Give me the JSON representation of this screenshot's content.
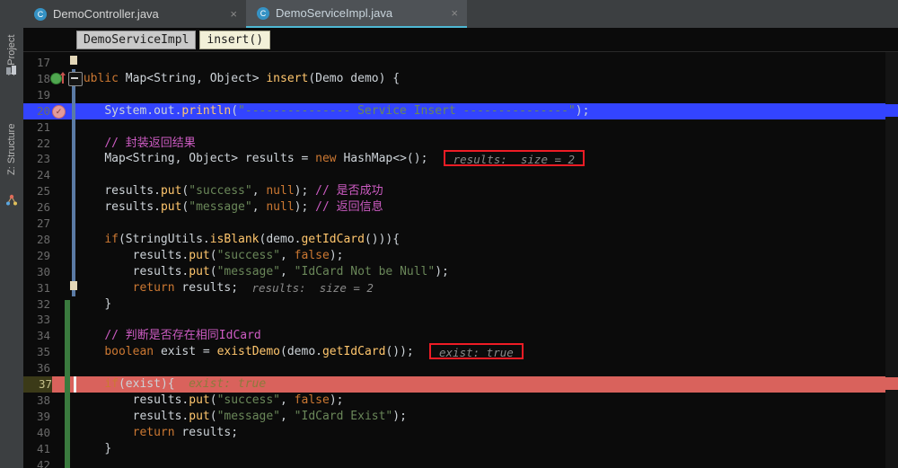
{
  "window": {
    "sidebar": {
      "items": [
        {
          "label": "1: Project",
          "icon": "project-icon"
        },
        {
          "label": "Z: Structure",
          "icon": "structure-icon"
        }
      ]
    },
    "tabs": [
      {
        "label": "DemoController.java",
        "icon": "java-class-icon",
        "close": "×",
        "active": false
      },
      {
        "label": "DemoServiceImpl.java",
        "icon": "java-class-icon",
        "close": "×",
        "active": true
      }
    ],
    "breadcrumb": {
      "class_name": "DemoServiceImpl",
      "method_name": "insert()"
    }
  },
  "editor": {
    "first_line": 17,
    "last_line": 42,
    "current_line": 37,
    "gutter_icons": [
      {
        "line": 18,
        "icon": "run-gutter-icon"
      },
      {
        "line": 20,
        "icon": "breakpoint-verified-icon"
      }
    ],
    "lines": [
      {
        "n": 17,
        "indent": 0,
        "text": ""
      },
      {
        "n": 18,
        "indent": 0,
        "text": "public Map<String, Object> insert(Demo demo) {"
      },
      {
        "n": 19,
        "indent": 0,
        "text": ""
      },
      {
        "n": 20,
        "indent": 0,
        "text": "    System.out.println(\"--------------- Service Insert ---------------\");",
        "highlight": "blue"
      },
      {
        "n": 21,
        "indent": 0,
        "text": ""
      },
      {
        "n": 22,
        "indent": 0,
        "text": "    // 封装返回结果"
      },
      {
        "n": 23,
        "indent": 0,
        "text": "    Map<String, Object> results = new HashMap<>();"
      },
      {
        "n": 24,
        "indent": 0,
        "text": ""
      },
      {
        "n": 25,
        "indent": 0,
        "text": "    results.put(\"success\", null); // 是否成功"
      },
      {
        "n": 26,
        "indent": 0,
        "text": "    results.put(\"message\", null); // 返回信息"
      },
      {
        "n": 27,
        "indent": 0,
        "text": ""
      },
      {
        "n": 28,
        "indent": 0,
        "text": "    if(StringUtils.isBlank(demo.getIdCard())){"
      },
      {
        "n": 29,
        "indent": 0,
        "text": "        results.put(\"success\", false);"
      },
      {
        "n": 30,
        "indent": 0,
        "text": "        results.put(\"message\", \"IdCard Not be Null\");"
      },
      {
        "n": 31,
        "indent": 0,
        "text": "        return results;"
      },
      {
        "n": 32,
        "indent": 0,
        "text": "    }"
      },
      {
        "n": 33,
        "indent": 0,
        "text": ""
      },
      {
        "n": 34,
        "indent": 0,
        "text": "    // 判断是否存在相同IdCard"
      },
      {
        "n": 35,
        "indent": 0,
        "text": "    boolean exist = existDemo(demo.getIdCard());"
      },
      {
        "n": 36,
        "indent": 0,
        "text": ""
      },
      {
        "n": 37,
        "indent": 0,
        "text": "    if(exist){",
        "highlight": "red"
      },
      {
        "n": 38,
        "indent": 0,
        "text": "        results.put(\"success\", false);"
      },
      {
        "n": 39,
        "indent": 0,
        "text": "        results.put(\"message\", \"IdCard Exist\");"
      },
      {
        "n": 40,
        "indent": 0,
        "text": "        return results;"
      },
      {
        "n": 41,
        "indent": 0,
        "text": "    }"
      },
      {
        "n": 42,
        "indent": 0,
        "text": ""
      }
    ],
    "inline_hints": [
      {
        "line": 23,
        "text": "results:  size = 2",
        "boxed": true,
        "highlight_color": "#ee1c25"
      },
      {
        "line": 31,
        "text": "results:  size = 2",
        "boxed": false
      },
      {
        "line": 35,
        "text": "exist: true",
        "boxed": true,
        "highlight_color": "#ee1c25"
      },
      {
        "line": 37,
        "text": "exist: true",
        "boxed": false,
        "on_exec_line": true
      }
    ]
  },
  "colors": {
    "accent_tab_underline": "#4eb8d4",
    "exec_line": "#d9625c",
    "selected_line": "#3344ff",
    "keyword": "#cc7832",
    "string": "#6a8759",
    "comment": "#cc5bc2",
    "method": "#ffc66d",
    "number": "#6897bb",
    "vcs_changed": "#3a7a3e",
    "hint_box_border": "#ee1c25"
  }
}
